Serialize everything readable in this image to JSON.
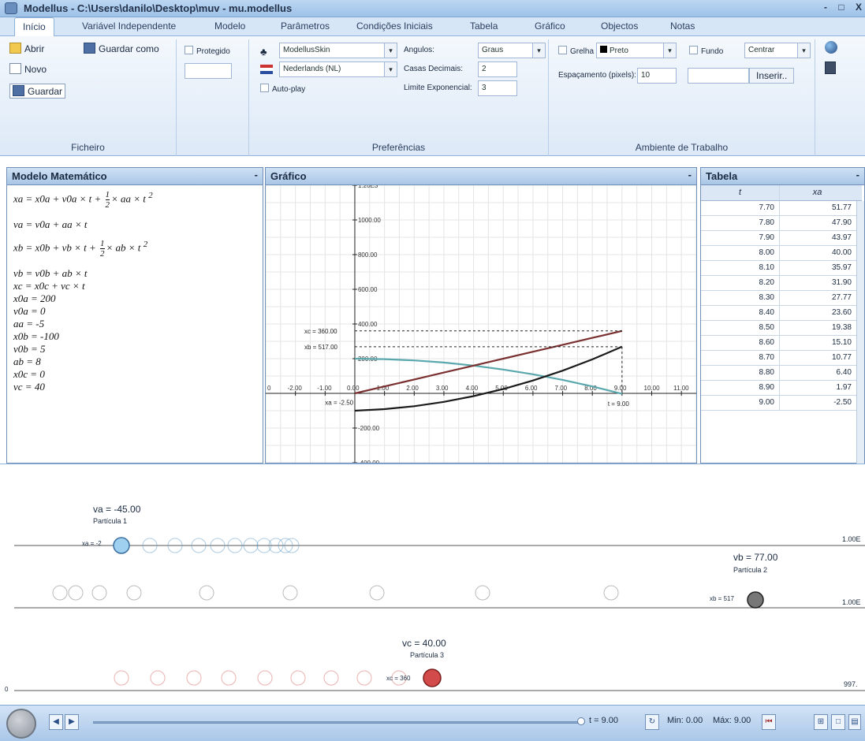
{
  "window": {
    "title": "Modellus - C:\\Users\\danilo\\Desktop\\muv - mu.modellus",
    "minimize": "-",
    "maximize": "□",
    "close": "X"
  },
  "tabs": [
    "Início",
    "Variável Independente",
    "Modelo",
    "Parâmetros",
    "Condições Iniciais",
    "Tabela",
    "Gráfico",
    "Objectos",
    "Notas"
  ],
  "ribbon": {
    "ficheiro": {
      "label": "Ficheiro",
      "abrir": "Abrir",
      "guardar_como": "Guardar como",
      "novo": "Novo",
      "guardar": "Guardar"
    },
    "protegido": "Protegido",
    "preferencias": {
      "label": "Preferências",
      "skin": "ModellusSkin",
      "language": "Nederlands (NL)",
      "autoplay": "Auto-play",
      "angulos_label": "Angulos:",
      "angulos_value": "Graus",
      "casas_label": "Casas Decimais:",
      "casas_value": "2",
      "limite_label": "Limite Exponencial:",
      "limite_value": "3"
    },
    "ambiente": {
      "label": "Ambiente de Trabalho",
      "grelha": "Grelha",
      "cor": "Preto",
      "fundo": "Fundo",
      "centrar": "Centrar",
      "espacamento_label": "Espaçamento (pixels):",
      "espacamento_value": "10",
      "inserir": "Inserir.."
    }
  },
  "modelo": {
    "title": "Modelo Matemático",
    "min": "-",
    "eq1": {
      "left": "xa = x0a + v0a × t + ",
      "num": "1",
      "den": "2",
      "right": "× aa × t ",
      "exp": "2"
    },
    "eq2": "va = v0a + aa × t",
    "eq3": {
      "left": "xb = x0b + vb × t + ",
      "num": "1",
      "den": "2",
      "right": "× ab × t ",
      "exp": "2"
    },
    "lines": [
      "vb = v0b + ab × t",
      "xc = x0c + vc × t",
      "x0a = 200",
      "v0a = 0",
      "aa = -5",
      "x0b = -100",
      "v0b = 5",
      "ab = 8",
      "x0c = 0",
      "vc = 40"
    ]
  },
  "grafico": {
    "title": "Gráfico",
    "min": "-",
    "xticks": [
      "-2.00",
      "-1.00",
      "0.00",
      "1.00",
      "2.00",
      "3.00",
      "4.00",
      "5.00",
      "6.00",
      "7.00",
      "8.00",
      "9.00",
      "10.00",
      "11.00"
    ],
    "yticks": [
      "1.20E3",
      "1000.00",
      "800.00",
      "600.00",
      "400.00",
      "200.00",
      "",
      "-200.00",
      "-400.00"
    ],
    "label_xb": "xb = 517.00",
    "label_xc": "xc = 360.00",
    "label_xa": "xa = -2.50",
    "label_t": "t = 9.00",
    "label_o": "0"
  },
  "chart_data": {
    "type": "line",
    "xlabel": "t",
    "xlim": [
      -3,
      11.5
    ],
    "ylim": [
      -400,
      1200
    ],
    "grid": true,
    "series": [
      {
        "name": "xa",
        "color": "#5aa8ad",
        "x": [
          0,
          1,
          2,
          3,
          4,
          5,
          6,
          7,
          8,
          9
        ],
        "y": [
          200,
          197.5,
          190,
          177.5,
          160,
          137.5,
          110,
          77.5,
          40,
          -2.5
        ]
      },
      {
        "name": "xb",
        "color": "#1b1b1b",
        "x": [
          0,
          1,
          2,
          3,
          4,
          5,
          6,
          7,
          8,
          9
        ],
        "y": [
          -100,
          -91,
          -74,
          -49,
          -16,
          25,
          74,
          131,
          196,
          269
        ]
      },
      {
        "name": "xc",
        "color": "#7a3030",
        "x": [
          0,
          1,
          2,
          3,
          4,
          5,
          6,
          7,
          8,
          9
        ],
        "y": [
          0,
          40,
          80,
          120,
          160,
          200,
          240,
          280,
          320,
          360
        ]
      }
    ]
  },
  "tabela": {
    "title": "Tabela",
    "min": "-",
    "col1": "t",
    "col2": "xa",
    "rows": [
      [
        "7.70",
        "51.77"
      ],
      [
        "7.80",
        "47.90"
      ],
      [
        "7.90",
        "43.97"
      ],
      [
        "8.00",
        "40.00"
      ],
      [
        "8.10",
        "35.97"
      ],
      [
        "8.20",
        "31.90"
      ],
      [
        "8.30",
        "27.77"
      ],
      [
        "8.40",
        "23.60"
      ],
      [
        "8.50",
        "19.38"
      ],
      [
        "8.60",
        "15.10"
      ],
      [
        "8.70",
        "10.77"
      ],
      [
        "8.80",
        "6.40"
      ],
      [
        "8.90",
        "1.97"
      ],
      [
        "9.00",
        "-2.50"
      ]
    ]
  },
  "animacao": {
    "p1_label": "va = -45.00",
    "p1_name": "Partícula 1",
    "p1_x": "xa = -2",
    "p2_label": "vb = 77.00",
    "p2_name": "Partícula 2",
    "p2_x": "xb = 517",
    "p3_label": "vc = 40.00",
    "p3_name": "Partícula 3",
    "p3_x": "xc = 360",
    "scale1": "1.00E",
    "scale2": "1.00E",
    "scale3": "997.",
    "left_mark": "0"
  },
  "controls": {
    "t_label": "t = 9.00",
    "min_label": "Min: 0.00",
    "max_label": "Máx: 9.00"
  }
}
